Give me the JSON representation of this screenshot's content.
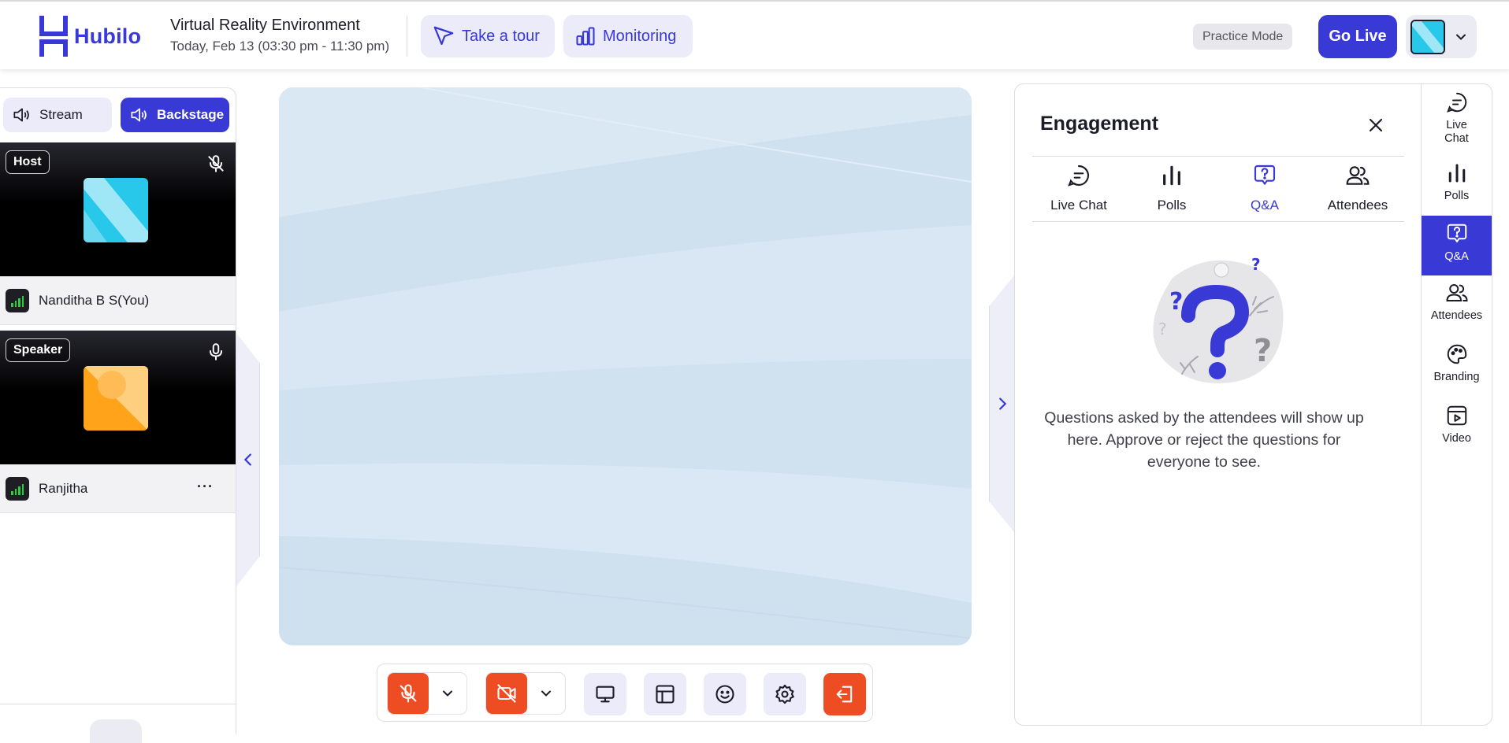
{
  "header": {
    "brand": "Hubilo",
    "event_title": "Virtual Reality Environment",
    "event_date": "Today, Feb 13 (03:30 pm - 11:30 pm)",
    "tour_label": "Take a tour",
    "monitoring_label": "Monitoring",
    "practice_mode_label": "Practice Mode",
    "go_live_label": "Go Live"
  },
  "left_panel": {
    "stream_label": "Stream",
    "backstage_label": "Backstage",
    "participants": [
      {
        "role": "Host",
        "name": "Nanditha B S(You)",
        "mic": "muted"
      },
      {
        "role": "Speaker",
        "name": "Ranjitha",
        "mic": "on",
        "more": "···"
      }
    ]
  },
  "engagement": {
    "title": "Engagement",
    "tabs": [
      {
        "label": "Live Chat",
        "icon": "chat-icon"
      },
      {
        "label": "Polls",
        "icon": "polls-icon"
      },
      {
        "label": "Q&A",
        "icon": "qa-icon"
      },
      {
        "label": "Attendees",
        "icon": "attendees-icon"
      }
    ],
    "active_tab": "Q&A",
    "empty_message": "Questions asked by the attendees will show up here. Approve or reject the questions for everyone to see."
  },
  "rail": {
    "items": [
      {
        "label": "Live Chat",
        "icon": "chat-icon"
      },
      {
        "label": "Polls",
        "icon": "polls-icon"
      },
      {
        "label": "Q&A",
        "icon": "qa-icon"
      },
      {
        "label": "Attendees",
        "icon": "attendees-icon"
      },
      {
        "label": "Branding",
        "icon": "palette-icon"
      },
      {
        "label": "Video",
        "icon": "video-icon"
      }
    ]
  },
  "colors": {
    "accent": "#3939d6",
    "accent_soft": "#ebebf9",
    "danger": "#ee4d24",
    "stage": "#d7e6f3"
  }
}
